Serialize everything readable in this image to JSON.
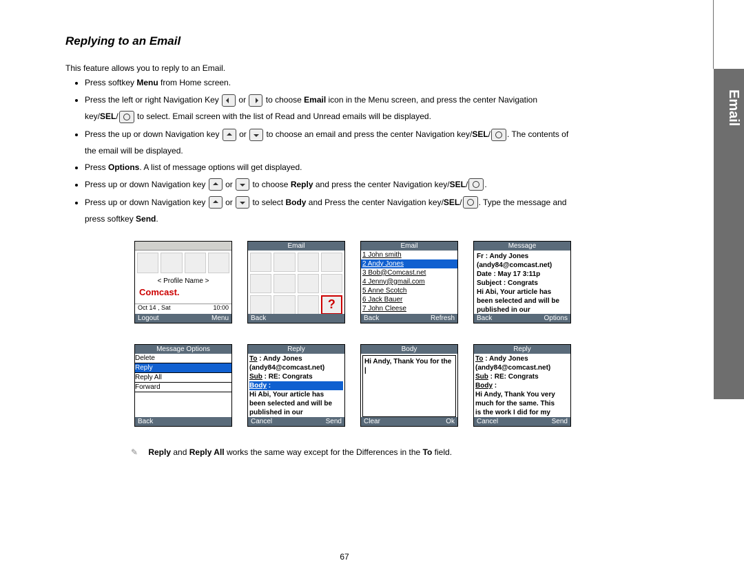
{
  "side_label": "Email",
  "title": "Replying to an Email",
  "intro": "This feature allows you to reply to an Email.",
  "bullets": {
    "b1_a": "Press softkey ",
    "b1_b": "Menu",
    "b1_c": " from Home screen.",
    "b2_a": "Press the left or right Navigation Key ",
    "b2_b": " or ",
    "b2_c": " to choose ",
    "b2_d": "Email",
    "b2_e": " icon in the Menu screen, and press the center Navigation key/",
    "b2_f": "SEL",
    "b2_g": "/",
    "b2_h": " to select. Email screen with the list of Read and Unread emails will be displayed.",
    "b3_a": "Press the up or down Navigation key ",
    "b3_b": " or ",
    "b3_c": " to choose an email and press the center Navigation key/",
    "b3_d": "SEL",
    "b3_e": "/",
    "b3_f": ". The contents of the email will be displayed.",
    "b4_a": "Press ",
    "b4_b": "Options",
    "b4_c": ". A list of message options will get displayed.",
    "b5_a": "Press up or down Navigation key ",
    "b5_b": " or ",
    "b5_c": " to choose ",
    "b5_d": "Reply",
    "b5_e": " and press the center Navigation key/",
    "b5_f": "SEL",
    "b5_g": "/",
    "b5_h": ".",
    "b6_a": "Press up or down Navigation key ",
    "b6_b": " or ",
    "b6_c": " to select ",
    "b6_d": "Body",
    "b6_e": " and Press the center Navigation key/",
    "b6_f": "SEL",
    "b6_g": "/",
    "b6_h": ". Type the message and press softkey ",
    "b6_i": "Send",
    "b6_j": "."
  },
  "screens": {
    "home": {
      "profile": "< Profile Name >",
      "brand": "Comcast.",
      "date": "Oct 14 , Sat",
      "time": "10:00",
      "left": "Logout",
      "right": "Menu"
    },
    "menu": {
      "title": "Email",
      "left": "Back",
      "right": ""
    },
    "list": {
      "title": "Email",
      "items": [
        "1 John smith",
        "2 Andy Jones",
        "3 Bob@Comcast.net",
        "4 Jenny@gmail.com",
        "5 Anne Scotch",
        "6 Jack Bauer",
        "7 John Cleese"
      ],
      "left": "Back",
      "right": "Refresh"
    },
    "msg": {
      "title": "Message",
      "lines": [
        "Fr : Andy Jones",
        "(andy84@comcast.net)",
        "Date : May 17 3:11p",
        "Subject : Congrats",
        "Hi Abi,  Your article has",
        "been selected and will be",
        "published in our"
      ],
      "left": "Back",
      "right": "Options"
    },
    "opts": {
      "title": "Message Options",
      "items": [
        "Delete",
        "Reply",
        "Reply All",
        "Forward"
      ],
      "left": "Back",
      "right": ""
    },
    "reply1": {
      "title": "Reply",
      "to_lbl": "To",
      "to": " : Andy Jones",
      "addr": "(andy84@comcast.net)",
      "sub_lbl": "Sub",
      "sub": " : RE: Congrats",
      "body_lbl": "Body",
      "body_sep": " :",
      "lines": [
        "Hi Abi,  Your article has",
        "been selected and will be",
        "published in our"
      ],
      "left": "Cancel",
      "right": "Send"
    },
    "bodyedit": {
      "title": "Body",
      "text": "Hi Andy, Thank You for the |",
      "left": "Clear",
      "right": "Ok"
    },
    "reply2": {
      "title": "Reply",
      "to_lbl": "To",
      "to": " : Andy Jones",
      "addr": "(andy84@comcast.net)",
      "sub_lbl": "Sub",
      "sub": " : RE: Congrats",
      "body_lbl": "Body",
      "body_sep": " :",
      "lines": [
        "Hi Andy, Thank You very",
        "much for the same. This",
        "is the work I did for my"
      ],
      "left": "Cancel",
      "right": "Send"
    }
  },
  "note": {
    "a": "Reply",
    "b": " and ",
    "c": "Reply All",
    "d": " works the same way except for the Differences in the ",
    "e": "To",
    "f": " field."
  },
  "page_number": "67"
}
